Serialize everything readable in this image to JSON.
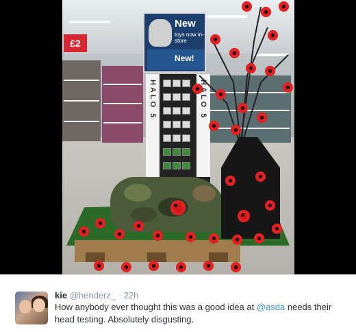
{
  "photo": {
    "price_sign": "£2",
    "promo_new_top": "New",
    "promo_sub": "toys now in-store",
    "promo_new_bottom": "New!",
    "halo_left": "HALO 5",
    "halo_right": "HALO 5"
  },
  "tweet": {
    "name": "kie",
    "handle": "@henderz_",
    "separator": "·",
    "time": "22h",
    "text_before": "How anybody ever thought this was a good idea at ",
    "mention": "@asda",
    "text_after": " needs their head testing. Absolutely disgusting."
  },
  "colors": {
    "poppy": "#d31818",
    "mention": "#3b94d9",
    "name": "#292f33",
    "muted": "#8899a6"
  }
}
